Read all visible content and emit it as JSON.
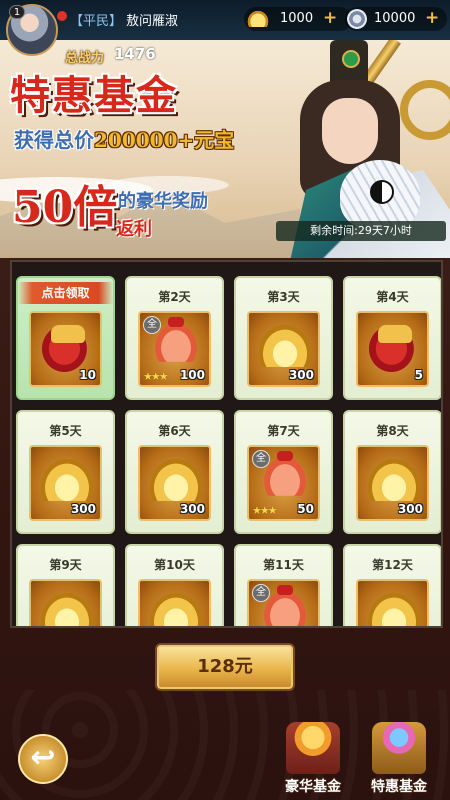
{
  "player": {
    "level": "1",
    "rank": "【平民】",
    "name": "敖问雁淑",
    "power_label": "总战力",
    "power_value": "1476"
  },
  "currency": [
    {
      "icon": "gold-ingot-icon",
      "value": "1000",
      "plus": "+"
    },
    {
      "icon": "silver-coin-icon",
      "value": "10000",
      "plus": "+"
    }
  ],
  "banner": {
    "title": "特惠基金",
    "line2_prefix": "获得总价",
    "line2_amount": "200000+元宝",
    "multiplier": "50倍",
    "line3": "的豪华奖励",
    "line4": "返利",
    "remaining": "剩余时间:29天7小时"
  },
  "cards": [
    {
      "label": "点击领取",
      "item": "bag",
      "qty": "10",
      "claimable": true,
      "badge": "",
      "stars": ""
    },
    {
      "label": "第2天",
      "item": "bell",
      "qty": "100",
      "claimable": false,
      "badge": "全",
      "stars": "★★★"
    },
    {
      "label": "第3天",
      "item": "ingot",
      "qty": "300",
      "claimable": false,
      "badge": "",
      "stars": ""
    },
    {
      "label": "第4天",
      "item": "bag",
      "qty": "5",
      "claimable": false,
      "badge": "",
      "stars": ""
    },
    {
      "label": "第5天",
      "item": "ingot",
      "qty": "300",
      "claimable": false,
      "badge": "",
      "stars": ""
    },
    {
      "label": "第6天",
      "item": "ingot",
      "qty": "300",
      "claimable": false,
      "badge": "",
      "stars": ""
    },
    {
      "label": "第7天",
      "item": "bell",
      "qty": "50",
      "claimable": false,
      "badge": "全",
      "stars": "★★★"
    },
    {
      "label": "第8天",
      "item": "ingot",
      "qty": "300",
      "claimable": false,
      "badge": "",
      "stars": ""
    },
    {
      "label": "第9天",
      "item": "ingot",
      "qty": "",
      "claimable": false,
      "badge": "",
      "stars": ""
    },
    {
      "label": "第10天",
      "item": "ingot",
      "qty": "",
      "claimable": false,
      "badge": "",
      "stars": ""
    },
    {
      "label": "第11天",
      "item": "bell",
      "qty": "",
      "claimable": false,
      "badge": "全",
      "stars": ""
    },
    {
      "label": "第12天",
      "item": "ingot",
      "qty": "",
      "claimable": false,
      "badge": "",
      "stars": ""
    }
  ],
  "purchase": {
    "label": "128元"
  },
  "back": {
    "icon": "back-arrow-icon",
    "glyph": "↩"
  },
  "tabs": [
    {
      "label": "豪华基金",
      "icon": "luxury-chest-icon"
    },
    {
      "label": "特惠基金",
      "icon": "discount-chest-icon"
    }
  ]
}
